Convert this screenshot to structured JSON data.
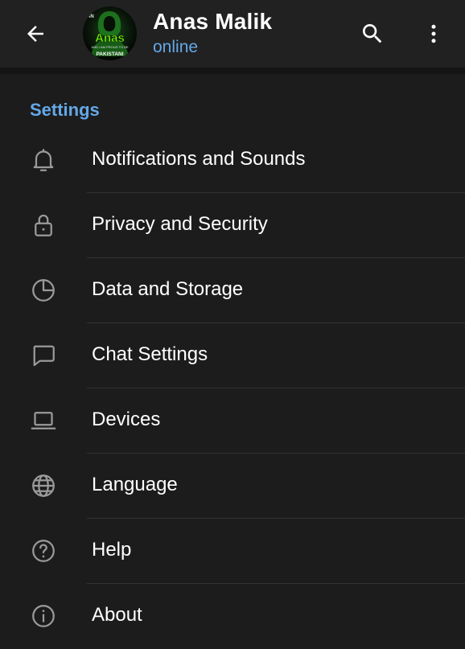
{
  "header": {
    "back_icon": "arrow-left-icon",
    "avatar": {
      "text": "Anas",
      "small_text_top": "AN",
      "small_text_line": "AND I AM PROUD TO BE",
      "small_text_bottom": "PAKISTANI"
    },
    "title": "Anas Malik",
    "status": "online",
    "search_icon": "search-icon",
    "more_icon": "more-vertical-icon"
  },
  "section": {
    "title": "Settings"
  },
  "items": [
    {
      "label": "Notifications and Sounds",
      "icon": "bell-icon"
    },
    {
      "label": "Privacy and Security",
      "icon": "lock-icon"
    },
    {
      "label": "Data and Storage",
      "icon": "pie-chart-icon"
    },
    {
      "label": "Chat Settings",
      "icon": "chat-bubble-icon"
    },
    {
      "label": "Devices",
      "icon": "laptop-icon"
    },
    {
      "label": "Language",
      "icon": "globe-icon"
    },
    {
      "label": "Help",
      "icon": "help-circle-icon"
    },
    {
      "label": "About",
      "icon": "info-icon"
    }
  ],
  "colors": {
    "background": "#1c1c1c",
    "header": "#212121",
    "accent": "#64a8e8",
    "icon": "#9a9a9a",
    "divider": "#333333"
  }
}
